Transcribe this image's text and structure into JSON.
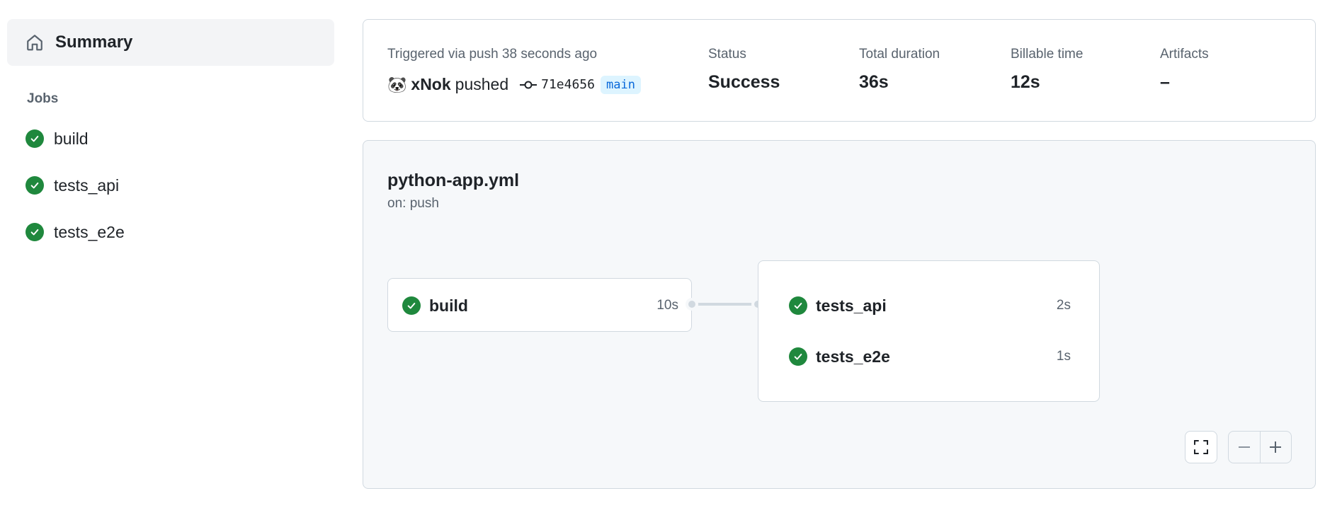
{
  "sidebar": {
    "summary_label": "Summary",
    "jobs_heading": "Jobs",
    "jobs": [
      {
        "label": "build",
        "status": "success"
      },
      {
        "label": "tests_api",
        "status": "success"
      },
      {
        "label": "tests_e2e",
        "status": "success"
      }
    ]
  },
  "run_summary": {
    "trigger_text": "Triggered via push 38 seconds ago",
    "avatar": "🐼",
    "actor": "xNok",
    "action": "pushed",
    "commit_sha": "71e4656",
    "branch": "main",
    "status_label": "Status",
    "status_value": "Success",
    "duration_label": "Total duration",
    "duration_value": "36s",
    "billable_label": "Billable time",
    "billable_value": "12s",
    "artifacts_label": "Artifacts",
    "artifacts_value": "–"
  },
  "workflow": {
    "file": "python-app.yml",
    "trigger": "on: push",
    "build_job": {
      "name": "build",
      "duration": "10s"
    },
    "group_jobs": [
      {
        "name": "tests_api",
        "duration": "2s"
      },
      {
        "name": "tests_e2e",
        "duration": "1s"
      }
    ]
  },
  "colors": {
    "success": "#1f883d",
    "branch_bg": "#ddf4ff",
    "branch_fg": "#0969da",
    "panel_bg": "#f6f8fa",
    "border": "#d1d9e0"
  },
  "icons": {
    "summary": "home-icon",
    "job_status": "check-circle-icon",
    "commit": "git-commit-icon",
    "fullscreen": "fullscreen-icon",
    "zoom_out": "minus-icon",
    "zoom_in": "plus-icon"
  }
}
